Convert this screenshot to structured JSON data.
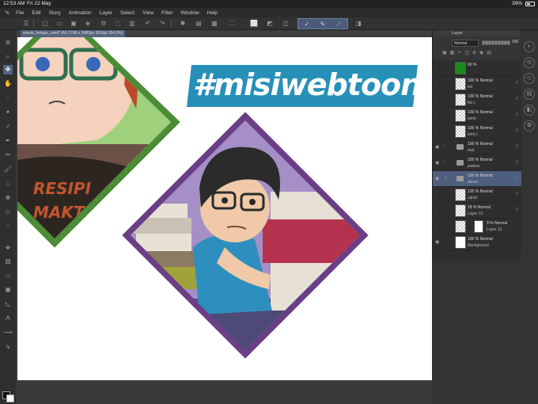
{
  "status": {
    "time": "12:53 AM",
    "date": "Fri 22 May",
    "battery": "39%"
  },
  "menu": [
    "File",
    "Edit",
    "Story",
    "Animation",
    "Layer",
    "Select",
    "View",
    "Filter",
    "Window",
    "Help"
  ],
  "document": {
    "tab": "ebook_belajar_comi* (A5 1748 x 2480px 300dpi 194.0%)"
  },
  "canvas": {
    "hashtag": "#misiwebtoon"
  },
  "layer_panel": {
    "title": "Layer",
    "blend_mode": "Normal",
    "opacity": "100",
    "layers": [
      {
        "opacity": "60 %",
        "mode": "",
        "name": "",
        "kind": "fill"
      },
      {
        "opacity": "100 %",
        "mode": "Normal",
        "name": "kiri",
        "kind": "raster"
      },
      {
        "opacity": "100 %",
        "mode": "Normal",
        "name": "fizi c",
        "kind": "raster"
      },
      {
        "opacity": "100 %",
        "mode": "Normal",
        "name": "kemi",
        "kind": "raster"
      },
      {
        "opacity": "100 %",
        "mode": "Normal",
        "name": "kimi c",
        "kind": "raster"
      },
      {
        "opacity": "100 %",
        "mode": "Normal",
        "name": "mat",
        "kind": "folder"
      },
      {
        "opacity": "100 %",
        "mode": "Normal",
        "name": "pulana",
        "kind": "folder"
      },
      {
        "opacity": "100 %",
        "mode": "Normal",
        "name": "akowi",
        "kind": "folder"
      },
      {
        "opacity": "100 %",
        "mode": "Normal",
        "name": "zahid",
        "kind": "raster"
      },
      {
        "opacity": "18 %",
        "mode": "Normal",
        "name": "Layer 13",
        "kind": "raster"
      },
      {
        "opacity": "9 %",
        "mode": "Normal",
        "name": "Layer 12",
        "kind": "raster"
      },
      {
        "opacity": "100 %",
        "mode": "Normal",
        "name": "Background",
        "kind": "paper"
      }
    ]
  },
  "colors": {
    "accent": "#4e5e7e",
    "banner": "#2790b8",
    "green_frame": "#4c8c36",
    "purple_frame": "#6a3f86"
  }
}
